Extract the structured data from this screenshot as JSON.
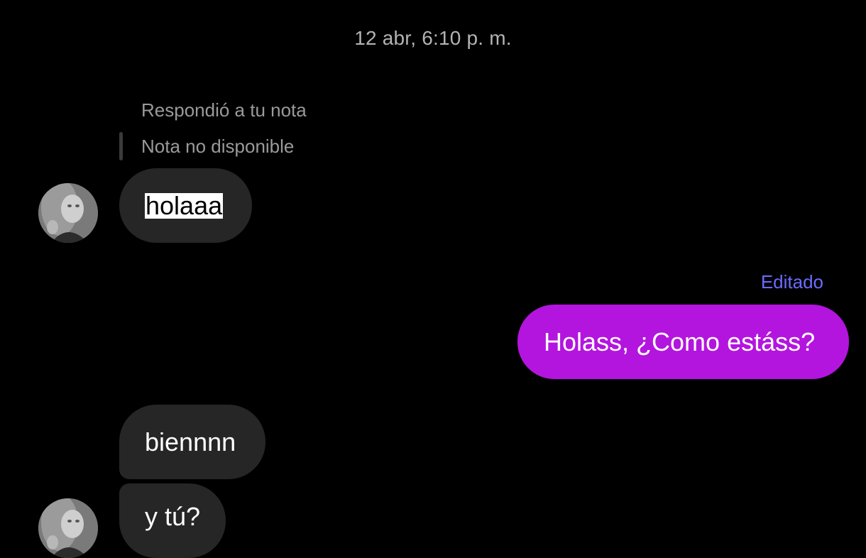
{
  "conversation": {
    "timestamp": "12 abr, 6:10 p. m.",
    "reply_context": {
      "label": "Respondió a tu nota",
      "quoted": "Nota no disponible"
    },
    "messages": [
      {
        "direction": "incoming",
        "text": "holaaa",
        "selected": true
      },
      {
        "direction": "outgoing",
        "text": "Holass, ¿Como estáss?",
        "edited_label": "Editado"
      },
      {
        "direction": "incoming",
        "text": "biennnn"
      },
      {
        "direction": "incoming",
        "text": "y tú?"
      }
    ]
  },
  "colors": {
    "background": "#000000",
    "incoming_bubble": "#262626",
    "outgoing_bubble": "#b315de",
    "edited_label": "#6b6bff",
    "muted_text": "#9a9a9a"
  }
}
